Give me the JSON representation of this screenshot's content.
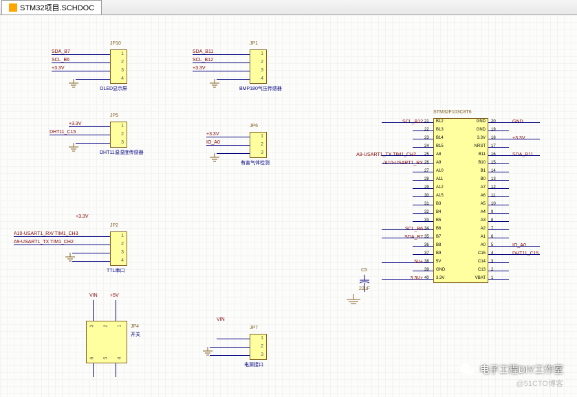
{
  "tab": {
    "title": "STM32项目.SCHDOC"
  },
  "blocks": {
    "jp10": {
      "ref": "JP10",
      "label": "OLED显示屏",
      "pins": [
        "1",
        "2",
        "3",
        "4"
      ],
      "nets": [
        "SDA_B7",
        "SCL_B6",
        "+3.3V"
      ]
    },
    "jp1": {
      "ref": "JP1",
      "label": "BMP180气压传感器",
      "pins": [
        "1",
        "2",
        "3",
        "4"
      ],
      "nets": [
        "SDA_B11",
        "SCL_B12",
        "+3.3V"
      ]
    },
    "jp5": {
      "ref": "JP5",
      "label": "DHT11温湿度传感器",
      "pins": [
        "1",
        "2",
        "3"
      ],
      "nets": [
        "+3.3V",
        "DHT11_C15"
      ]
    },
    "jp6": {
      "ref": "JP6",
      "label": "有害气体检测",
      "pins": [
        "1",
        "2",
        "3"
      ],
      "nets": [
        "+3.3V",
        "IO_A0"
      ]
    },
    "jp2": {
      "ref": "JP2",
      "label": "TTL串口",
      "pins": [
        "1",
        "2",
        "3",
        "4"
      ],
      "nets": [
        "+3.3V",
        "A10-USART1_RX/ TIM1_CH3",
        "A9-USART1_TX TIM1_CH2"
      ]
    },
    "jp4": {
      "ref": "JP4",
      "label": "开关",
      "nets_top": [
        "VIN",
        "+5V"
      ]
    },
    "jp7": {
      "ref": "JP7",
      "label": "电源接口",
      "pins": [
        "1",
        "2",
        "3"
      ],
      "nets": [
        "VIN"
      ]
    },
    "ic": {
      "ref": "STM32F103C8T6",
      "left_pins": [
        {
          "num": "21",
          "name": "B12"
        },
        {
          "num": "22",
          "name": "B13"
        },
        {
          "num": "23",
          "name": "B14"
        },
        {
          "num": "24",
          "name": "B15"
        },
        {
          "num": "25",
          "name": "A8"
        },
        {
          "num": "26",
          "name": "A9"
        },
        {
          "num": "27",
          "name": "A10"
        },
        {
          "num": "28",
          "name": "A11"
        },
        {
          "num": "29",
          "name": "A12"
        },
        {
          "num": "30",
          "name": "A15"
        },
        {
          "num": "31",
          "name": "B3"
        },
        {
          "num": "32",
          "name": "B4"
        },
        {
          "num": "33",
          "name": "B5"
        },
        {
          "num": "34",
          "name": "B6"
        },
        {
          "num": "35",
          "name": "B7"
        },
        {
          "num": "36",
          "name": "B8"
        },
        {
          "num": "37",
          "name": "B9"
        },
        {
          "num": "38",
          "name": "5V"
        },
        {
          "num": "39",
          "name": "GND"
        },
        {
          "num": "40",
          "name": "3.3V"
        }
      ],
      "right_pins": [
        {
          "num": "20",
          "name": "GND"
        },
        {
          "num": "19",
          "name": "GND"
        },
        {
          "num": "18",
          "name": "3.3V"
        },
        {
          "num": "17",
          "name": "NRST"
        },
        {
          "num": "16",
          "name": "B11"
        },
        {
          "num": "15",
          "name": "B10"
        },
        {
          "num": "14",
          "name": "B1"
        },
        {
          "num": "13",
          "name": "B0"
        },
        {
          "num": "12",
          "name": "A7"
        },
        {
          "num": "11",
          "name": "A6"
        },
        {
          "num": "10",
          "name": "A5"
        },
        {
          "num": "9",
          "name": "A4"
        },
        {
          "num": "8",
          "name": "A3"
        },
        {
          "num": "7",
          "name": "A2"
        },
        {
          "num": "6",
          "name": "A1"
        },
        {
          "num": "5",
          "name": "A0"
        },
        {
          "num": "4",
          "name": "C15"
        },
        {
          "num": "3",
          "name": "C14"
        },
        {
          "num": "2",
          "name": "C13"
        },
        {
          "num": "1",
          "name": "VBAT"
        }
      ],
      "left_nets": [
        "SCL_B12",
        "",
        "",
        "",
        "A9-USART1_TX TIM1_CH2",
        "A10-USART1_RX/",
        "",
        "",
        "",
        "",
        "",
        "",
        "",
        "SCL_B6",
        "SDA_B7",
        "",
        "",
        "+5V",
        "",
        "+3.3V"
      ],
      "right_nets": [
        "GND",
        "",
        "+3.3V",
        "",
        "SDA_B11",
        "",
        "",
        "",
        "",
        "",
        "",
        "",
        "",
        "",
        "",
        "IO_A0",
        "DHT11_C15",
        "",
        "",
        ""
      ]
    },
    "cap": {
      "ref": "C5",
      "val": "22uF"
    }
  },
  "watermark": {
    "main": "电子工程DIY工作室",
    "sub": "@51CTO博客"
  }
}
